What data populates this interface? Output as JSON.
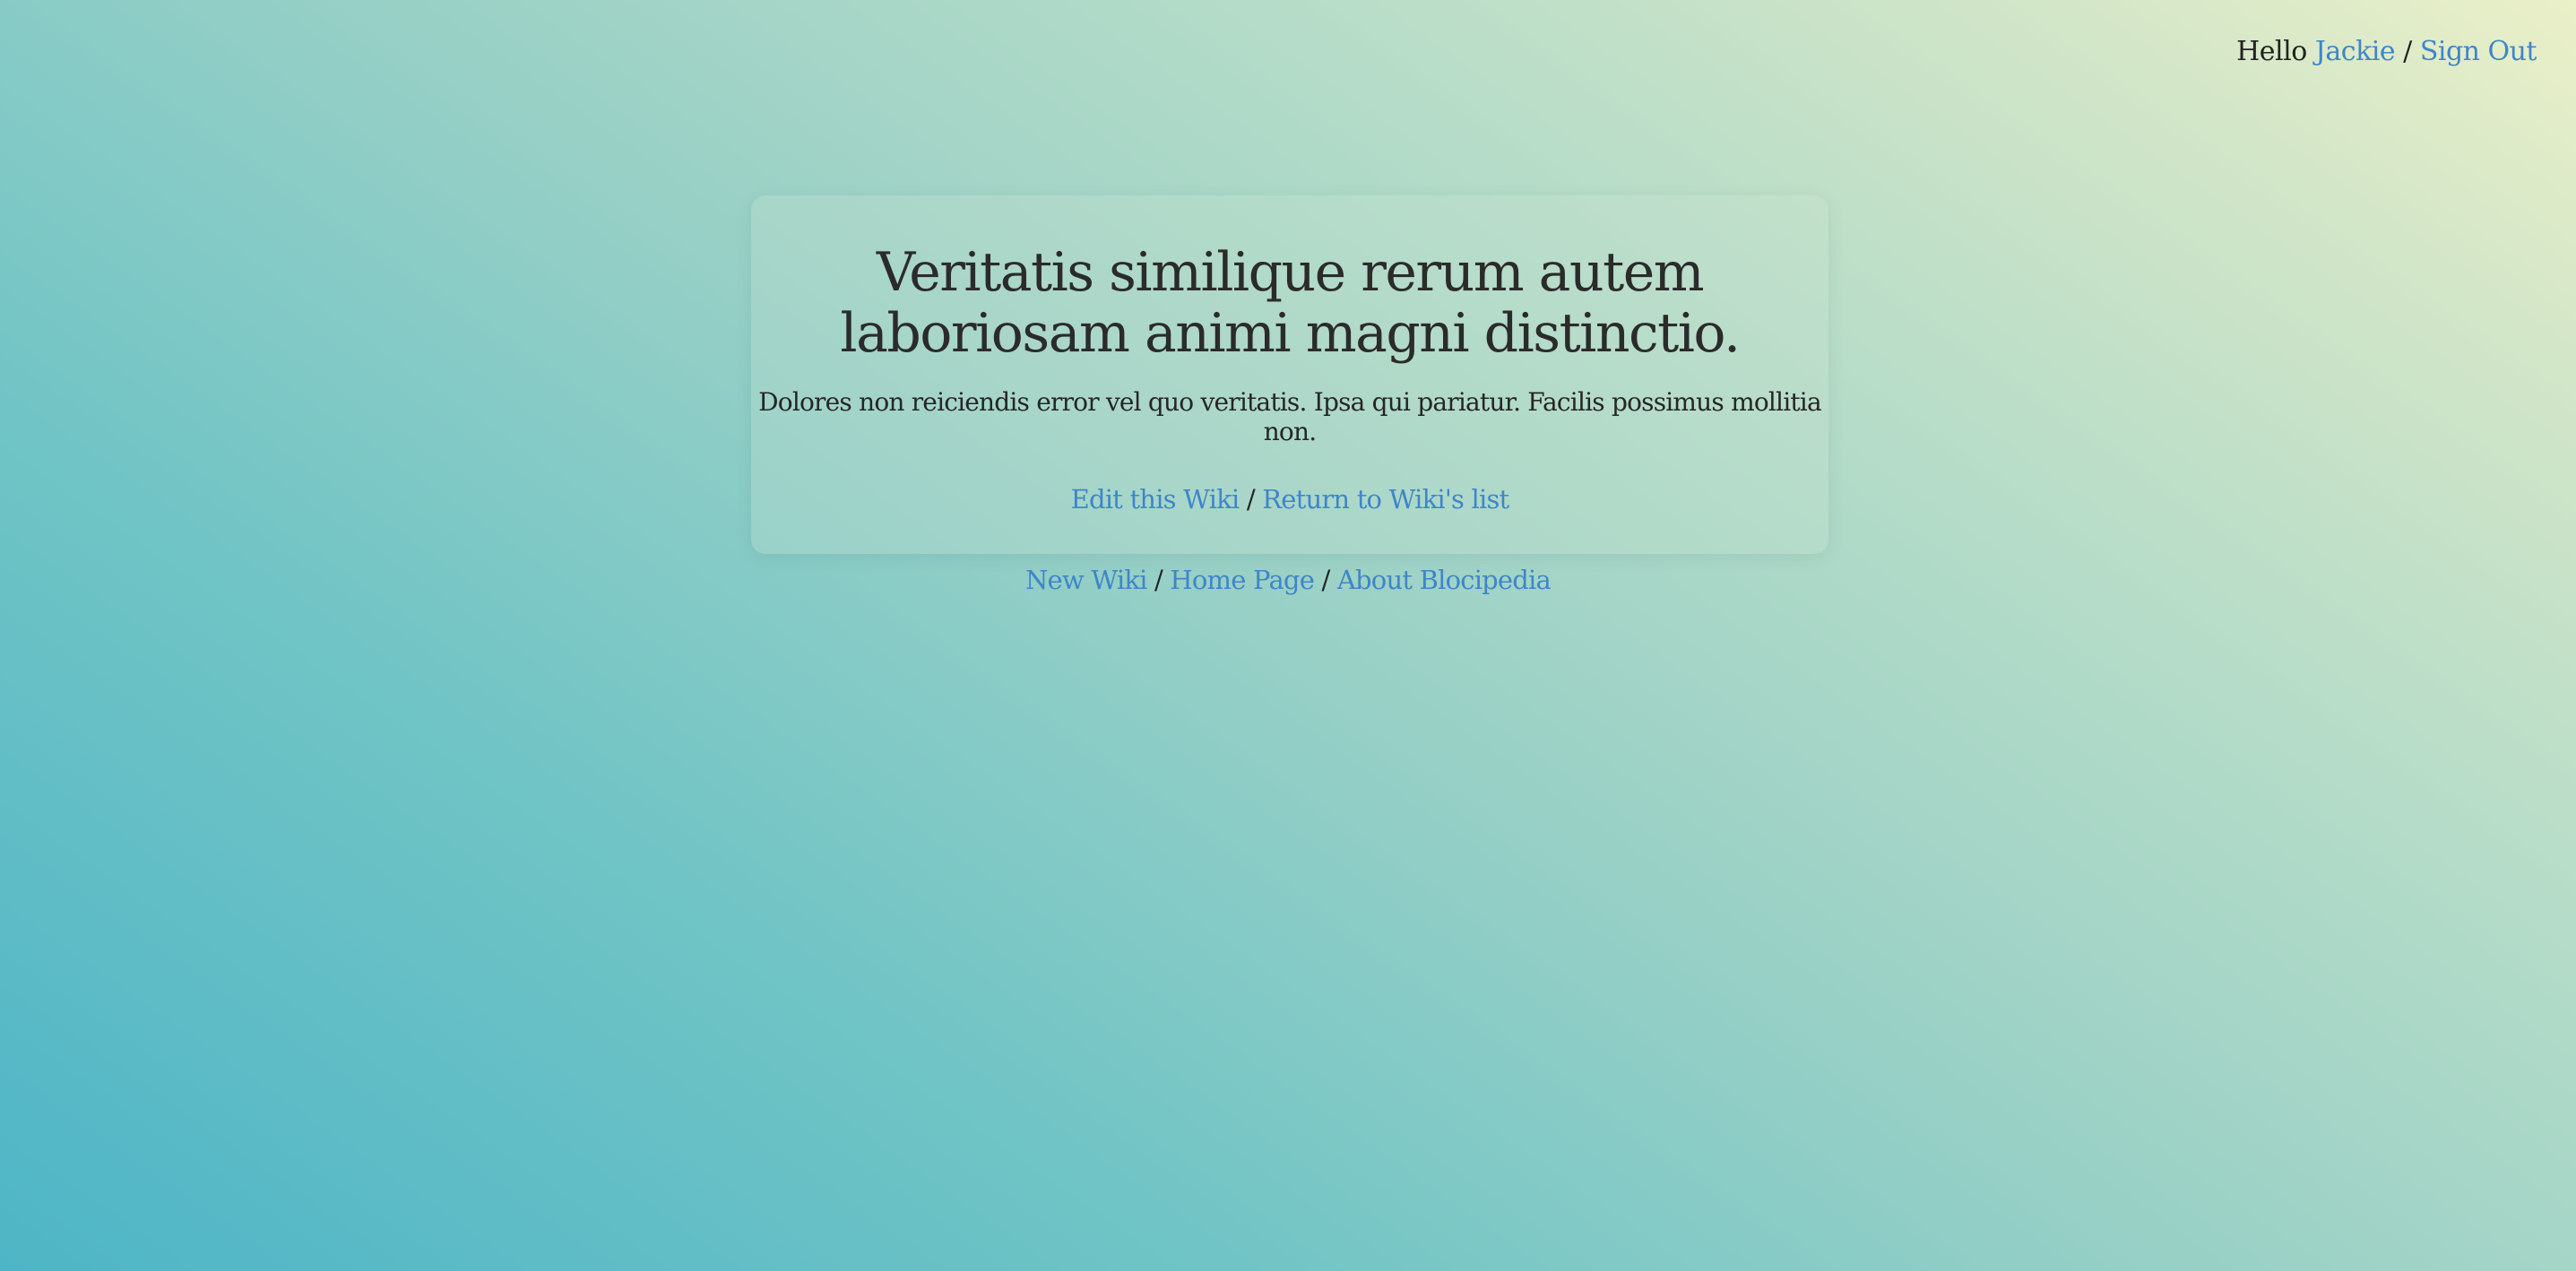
{
  "userbar": {
    "greeting": "Hello",
    "username": "Jackie",
    "separator": "/",
    "sign_out": "Sign Out"
  },
  "wiki": {
    "title": "Veritatis similique rerum autem laboriosam animi magni distinctio.",
    "body": "Dolores non reiciendis error vel quo veritatis. Ipsa qui pariatur. Facilis possimus mollitia non.",
    "links": {
      "edit": "Edit this Wiki",
      "separator": "/",
      "return": "Return to Wiki's list"
    }
  },
  "footer": {
    "new_wiki": "New Wiki",
    "sep1": "/",
    "home": "Home Page",
    "sep2": "/",
    "about": "About Blocipedia"
  },
  "colors": {
    "link": "#3f86c9",
    "text": "#2a2a2a"
  }
}
